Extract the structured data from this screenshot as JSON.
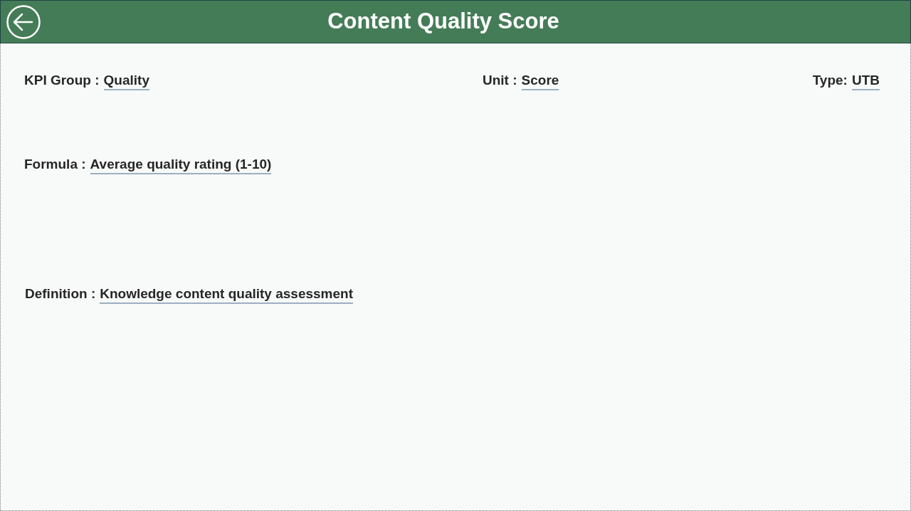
{
  "header": {
    "title": "Content Quality Score"
  },
  "summary_row": [
    {
      "label": "KPI Group :",
      "value": "Quality"
    },
    {
      "label": "Unit :",
      "value": "Score"
    },
    {
      "label": "Type:",
      "value": "UTB"
    }
  ],
  "formula": {
    "label": "Formula :",
    "value": "Average quality rating (1-10)"
  },
  "definition": {
    "label": "Definition :",
    "value": "Knowledge content quality assessment"
  }
}
